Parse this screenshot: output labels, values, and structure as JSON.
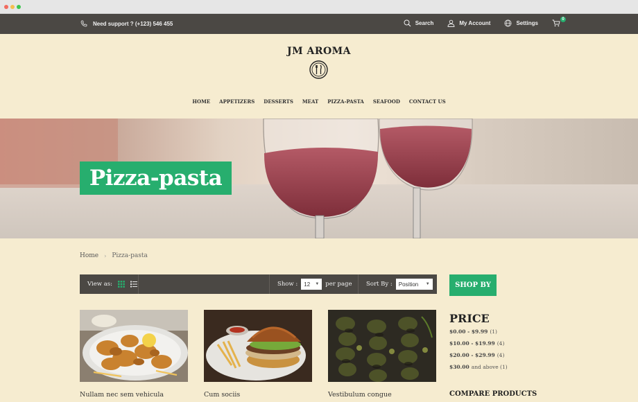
{
  "topbar": {
    "support_text": "Need support ? (+123) 546 455",
    "search_label": "Search",
    "account_label": "My Account",
    "settings_label": "Settings",
    "cart_count": "0"
  },
  "header": {
    "logo_text": "JM AROMA"
  },
  "nav": {
    "items": [
      "HOME",
      "APPETIZERS",
      "DESSERTS",
      "MEAT",
      "PIZZA-PASTA",
      "SEAFOOD",
      "CONTACT US"
    ]
  },
  "hero": {
    "title": "Pizza-pasta"
  },
  "breadcrumb": {
    "home": "Home",
    "current": "Pizza-pasta"
  },
  "toolbar": {
    "view_as_label": "View as:",
    "show_label": "Show :",
    "show_value": "12",
    "per_page_label": "per page",
    "sort_label": "Sort By :",
    "sort_value": "Position"
  },
  "products": [
    {
      "name": "Nullam nec sem vehicula"
    },
    {
      "name": "Cum sociis"
    },
    {
      "name": "Vestibulum congue"
    }
  ],
  "sidebar": {
    "shop_by_label": "SHOP BY",
    "price_title": "PRICE",
    "price_ranges": [
      {
        "range": "$0.00 - $9.99",
        "count": "(1)"
      },
      {
        "range": "$10.00 - $19.99",
        "count": "(4)"
      },
      {
        "range": "$20.00 - $29.99",
        "count": "(4)"
      },
      {
        "range": "$30.00",
        "count": "and above (1)"
      }
    ],
    "compare_title": "COMPARE PRODUCTS"
  },
  "colors": {
    "accent": "#27ae6e",
    "bar": "#4b4844",
    "background": "#f6ecd0"
  }
}
